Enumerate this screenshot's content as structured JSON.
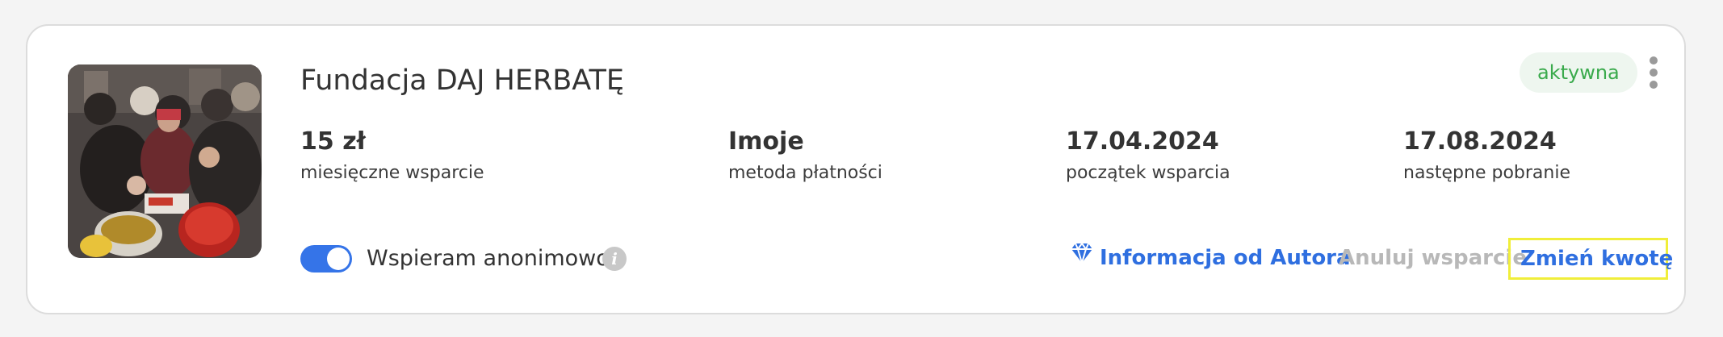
{
  "card": {
    "title": "Fundacja DAJ HERBATĘ",
    "status": "aktywna",
    "status_color": "#3aaa4c",
    "image_alt": "Fundacja DAJ HERBATĘ photo",
    "menu_icon": "more-vertical-icon"
  },
  "stats": [
    {
      "value": "15 zł",
      "label": "miesięczne wsparcie"
    },
    {
      "value": "Imoje",
      "label": "metoda płatności"
    },
    {
      "value": "17.04.2024",
      "label": "początek wsparcia"
    },
    {
      "value": "17.08.2024",
      "label": "następne pobranie"
    }
  ],
  "anonymous": {
    "label": "Wspieram anonimowo",
    "enabled": true,
    "info_icon": "i"
  },
  "actions": {
    "author_info": "Informacja od Autora",
    "author_icon": "diamond-icon",
    "cancel": "Anuluj wsparcie",
    "change_amount": "Zmień kwotę"
  },
  "colors": {
    "accent": "#2f6fe0",
    "toggle": "#3574e8",
    "muted": "#b8b8b8",
    "highlight_border": "#f0ee3a"
  }
}
